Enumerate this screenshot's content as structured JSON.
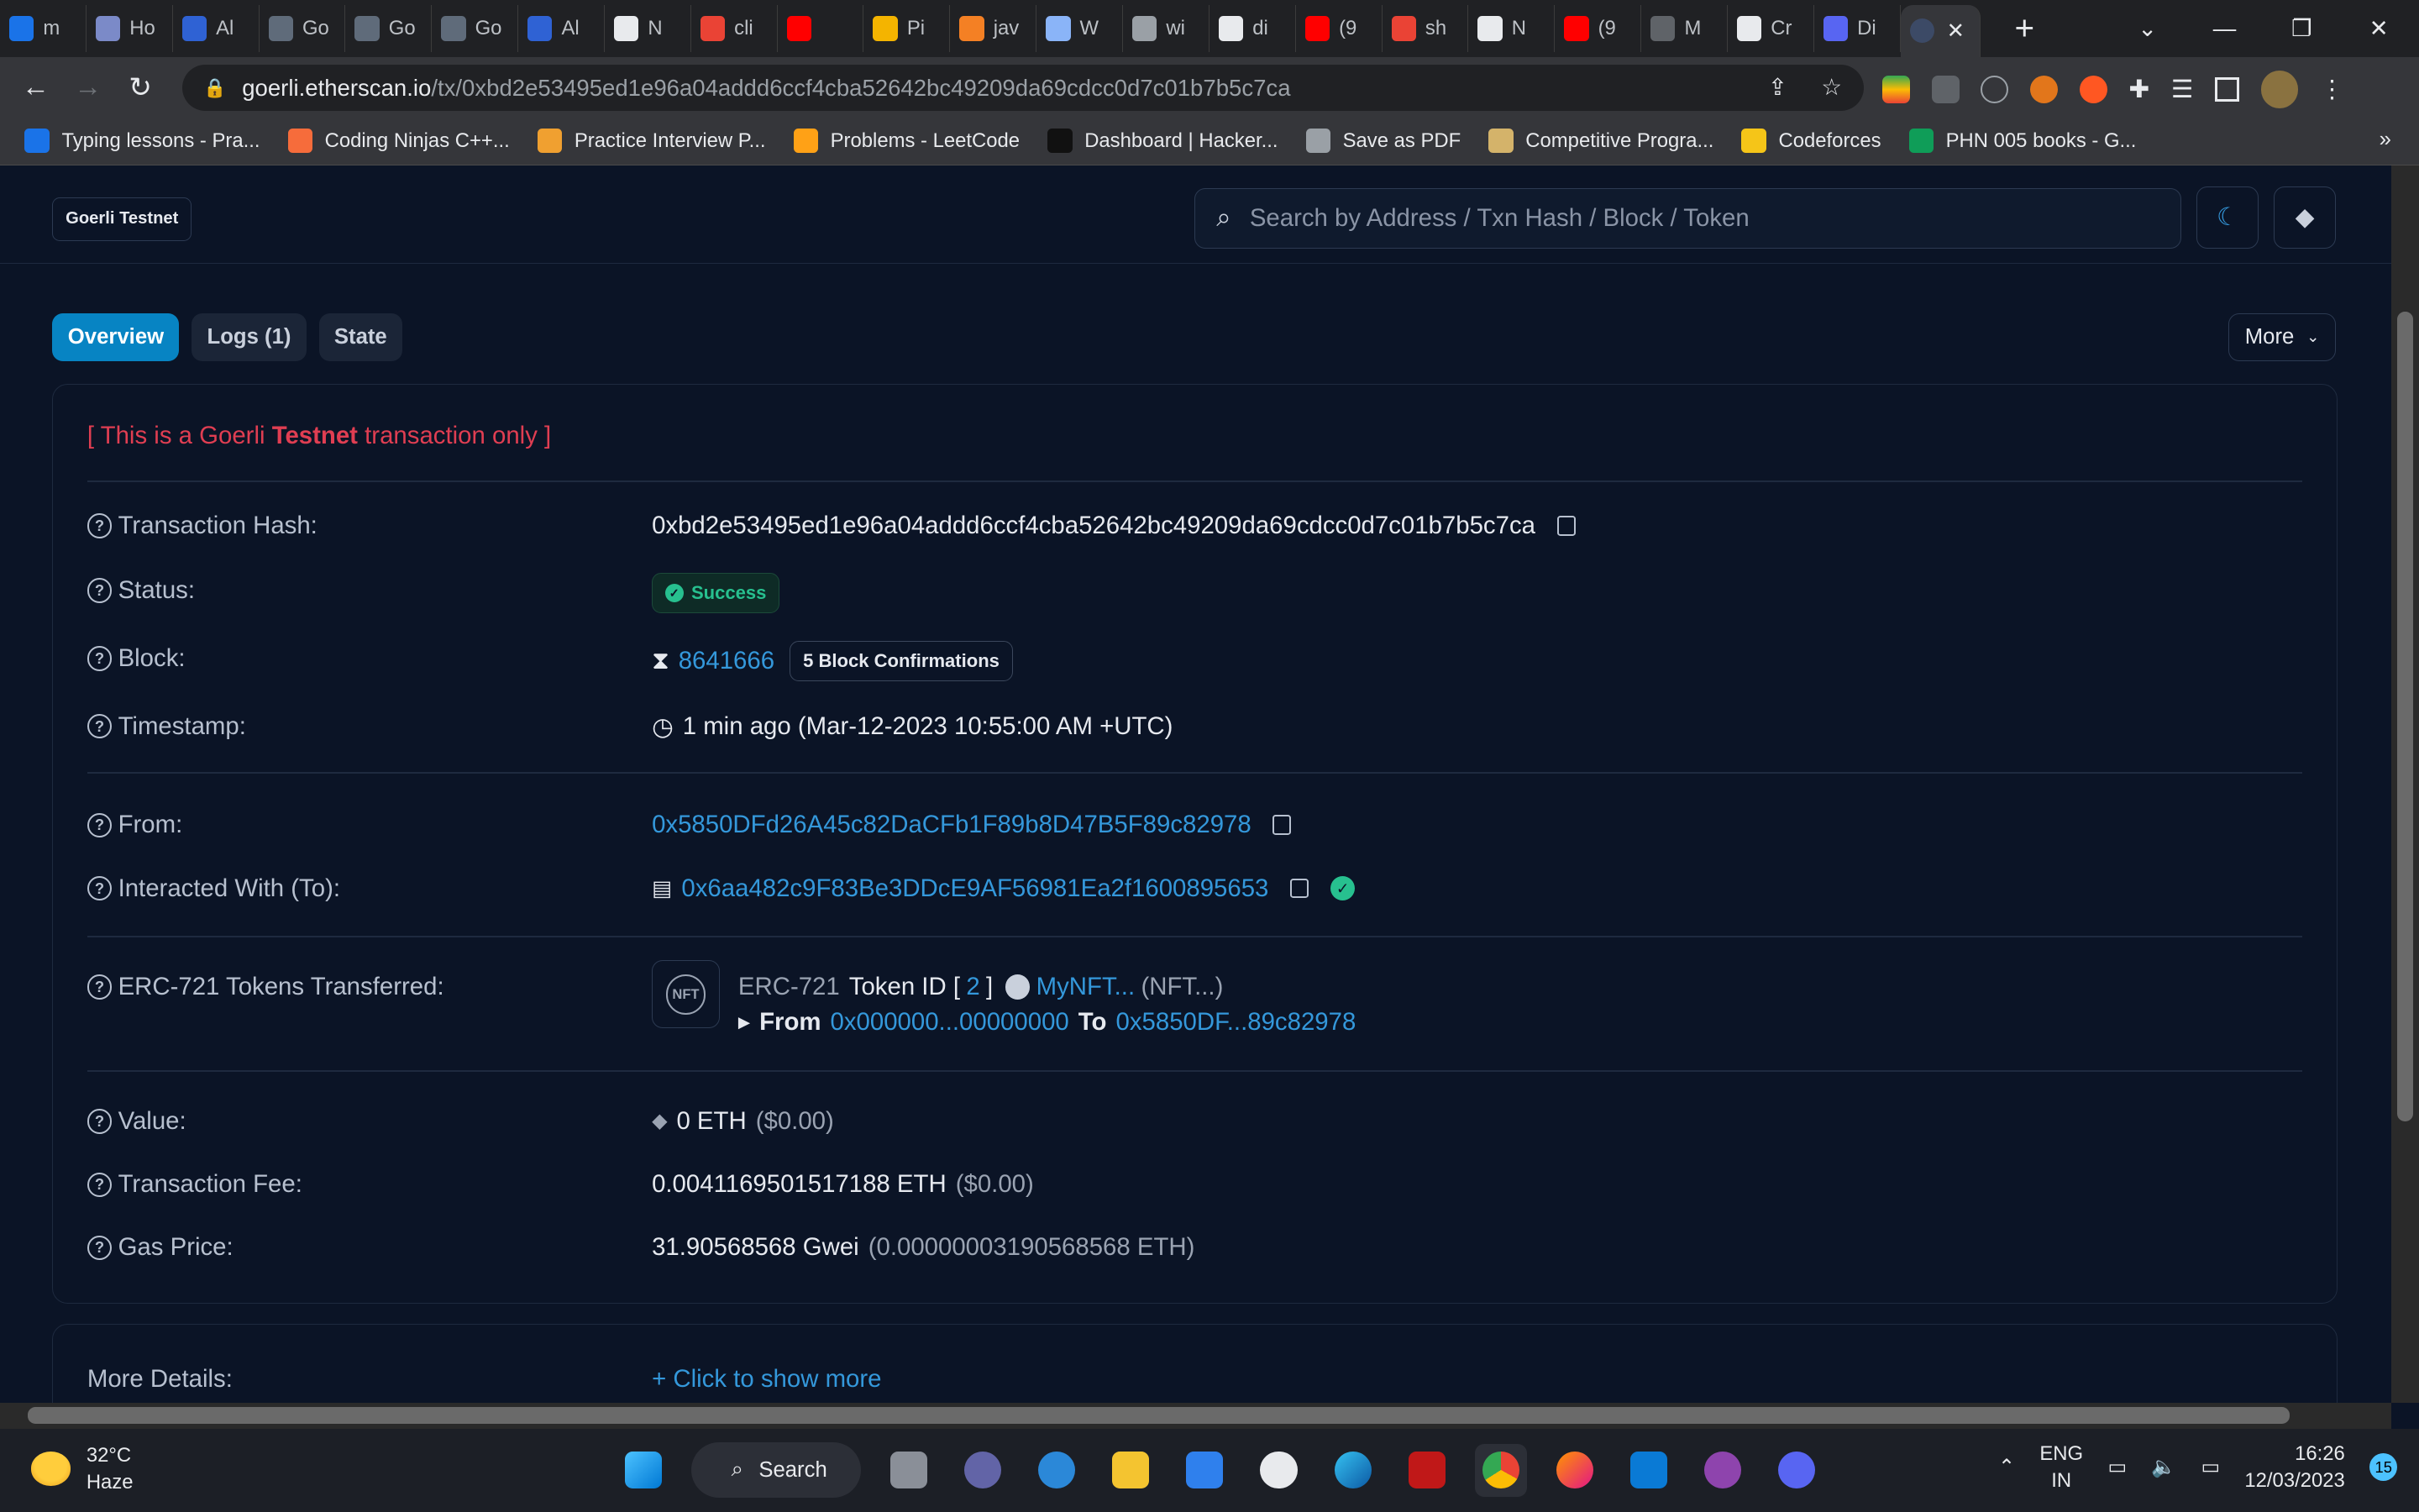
{
  "browser": {
    "tabs": [
      {
        "label": "m",
        "color": "#1a73e8"
      },
      {
        "label": "Ho",
        "color": "#7b8ac8"
      },
      {
        "label": "Al",
        "color": "#2f62d4"
      },
      {
        "label": "Go",
        "color": "#5f6b7a"
      },
      {
        "label": "Go",
        "color": "#5f6b7a"
      },
      {
        "label": "Go",
        "color": "#5f6b7a"
      },
      {
        "label": "Al",
        "color": "#2f62d4"
      },
      {
        "label": "N",
        "color": "#e8eaed"
      },
      {
        "label": "cli",
        "color": "#ea4335"
      },
      {
        "label": "",
        "color": "#ff0000"
      },
      {
        "label": "Pi",
        "color": "#f4b400"
      },
      {
        "label": "jav",
        "color": "#f48024"
      },
      {
        "label": "W",
        "color": "#8ab4f8"
      },
      {
        "label": "wi",
        "color": "#9aa0a6"
      },
      {
        "label": "di",
        "color": "#e8eaed"
      },
      {
        "label": "(9",
        "color": "#ff0000"
      },
      {
        "label": "sh",
        "color": "#ea4335"
      },
      {
        "label": "N",
        "color": "#e8eaed"
      },
      {
        "label": "(9",
        "color": "#ff0000"
      },
      {
        "label": "M",
        "color": "#5f6368"
      },
      {
        "label": "Cr",
        "color": "#e8eaed"
      },
      {
        "label": "Di",
        "color": "#5865f2"
      }
    ],
    "active_tab_close": "✕",
    "new_tab": "+",
    "url_host": "goerli.etherscan.io",
    "url_path": "/tx/0xbd2e53495ed1e96a04addd6ccf4cba52642bc49209da69cdcc0d7c01b7b5c7ca",
    "bookmarks": [
      {
        "label": "Typing lessons - Pra...",
        "color": "#1a73e8"
      },
      {
        "label": "Coding Ninjas C++...",
        "color": "#f66c3b"
      },
      {
        "label": "Practice Interview P...",
        "color": "#f0a030"
      },
      {
        "label": "Problems - LeetCode",
        "color": "#ffa116"
      },
      {
        "label": "Dashboard | Hacker...",
        "color": "#111111"
      },
      {
        "label": "Save as PDF",
        "color": "#9aa0a6"
      },
      {
        "label": "Competitive Progra...",
        "color": "#d4b36a"
      },
      {
        "label": "Codeforces",
        "color": "#f5c518"
      },
      {
        "label": "PHN 005 books - G...",
        "color": "#0f9d58"
      }
    ],
    "bookmarks_more": "»"
  },
  "page": {
    "network_badge": "Goerli Testnet",
    "search_placeholder": "Search by Address / Txn Hash / Block / Token",
    "tabs": [
      "Overview",
      "Logs (1)",
      "State"
    ],
    "more_label": "More",
    "notice_prefix": "[ This is a Goerli ",
    "notice_bold": "Testnet",
    "notice_suffix": " transaction only ]",
    "fields": {
      "tx_hash_label": "Transaction Hash:",
      "tx_hash": "0xbd2e53495ed1e96a04addd6ccf4cba52642bc49209da69cdcc0d7c01b7b5c7ca",
      "status_label": "Status:",
      "status": "Success",
      "block_label": "Block:",
      "block": "8641666",
      "confirmations": "5 Block Confirmations",
      "timestamp_label": "Timestamp:",
      "timestamp": "1 min ago (Mar-12-2023 10:55:00 AM +UTC)",
      "from_label": "From:",
      "from": "0x5850DFd26A45c82DaCFb1F89b8D47B5F89c82978",
      "to_label": "Interacted With (To):",
      "to": "0x6aa482c9F83Be3DDcE9AF56981Ea2f1600895653",
      "erc721_label": "ERC-721 Tokens Transferred:",
      "erc721_type": "ERC-721",
      "token_id_label": "Token ID [",
      "token_id": "2",
      "token_id_close": "]",
      "token_name": "MyNFT...",
      "token_symbol": "(NFT...)",
      "nft_icon_text": "NFT",
      "transfer_from_label": "From",
      "transfer_from": "0x000000...00000000",
      "transfer_to_label": "To",
      "transfer_to": "0x5850DF...89c82978",
      "value_label": "Value:",
      "value_eth": "0 ETH",
      "value_usd": "($0.00)",
      "fee_label": "Transaction Fee:",
      "fee_eth": "0.0041169501517188 ETH",
      "fee_usd": "($0.00)",
      "gas_label": "Gas Price:",
      "gas_gwei": "31.90568568 Gwei",
      "gas_eth": "(0.00000003190568568 ETH)",
      "more_details_label": "More Details:",
      "show_more": "+ Click to show more"
    }
  },
  "taskbar": {
    "temperature": "32°C",
    "weather": "Haze",
    "search_label": "Search",
    "lang_1": "ENG",
    "lang_2": "IN",
    "time": "16:26",
    "date": "12/03/2023",
    "notifications": "15"
  }
}
